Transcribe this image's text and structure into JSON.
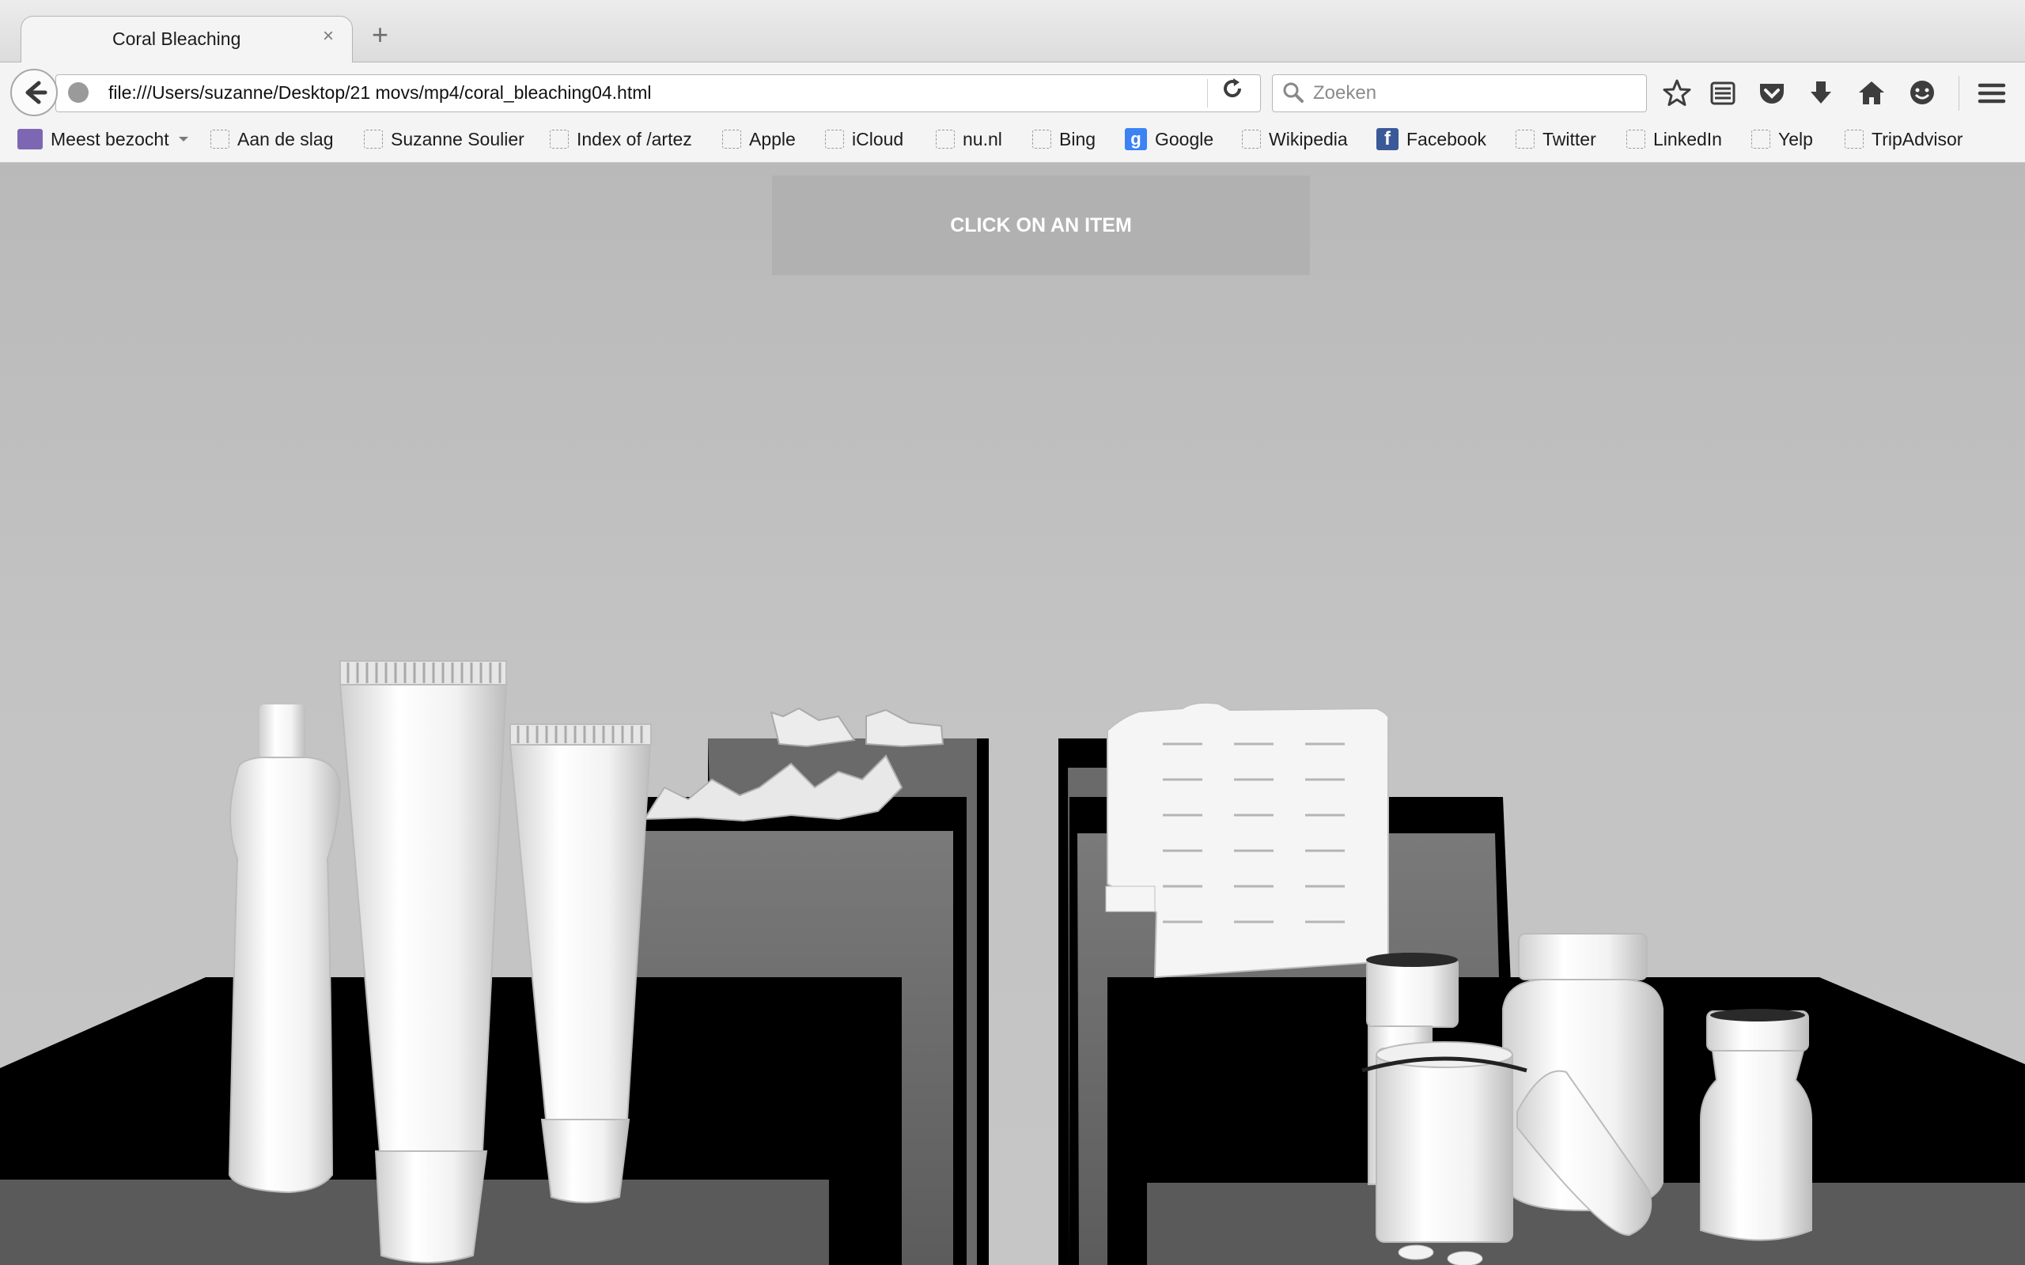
{
  "browser": {
    "tab_title": "Coral Bleaching",
    "tab_close": "×",
    "new_tab": "+",
    "url": "file:///Users/suzanne/Desktop/21 movs/mp4/coral_bleaching04.html",
    "search_placeholder": "Zoeken",
    "toolbar_icons": [
      "bookmark-star-icon",
      "reading-list-icon",
      "pocket-icon",
      "download-icon",
      "home-icon",
      "hello-chat-icon",
      "menu-icon"
    ]
  },
  "bookmarks": [
    {
      "label": "Meest bezocht",
      "icon": "folder-icon"
    },
    {
      "label": "Aan de slag",
      "icon": "blank-favicon"
    },
    {
      "label": "Suzanne Soulier",
      "icon": "blank-favicon"
    },
    {
      "label": "Index of /artez",
      "icon": "blank-favicon"
    },
    {
      "label": "Apple",
      "icon": "blank-favicon"
    },
    {
      "label": "iCloud",
      "icon": "blank-favicon"
    },
    {
      "label": "nu.nl",
      "icon": "blank-favicon"
    },
    {
      "label": "Bing",
      "icon": "blank-favicon"
    },
    {
      "label": "Google",
      "icon": "google-favicon"
    },
    {
      "label": "Wikipedia",
      "icon": "blank-favicon"
    },
    {
      "label": "Facebook",
      "icon": "facebook-favicon"
    },
    {
      "label": "Twitter",
      "icon": "blank-favicon"
    },
    {
      "label": "LinkedIn",
      "icon": "blank-favicon"
    },
    {
      "label": "Yelp",
      "icon": "blank-favicon"
    },
    {
      "label": "TripAdvisor",
      "icon": "blank-favicon"
    }
  ],
  "page": {
    "banner_text": "CLICK ON AN ITEM",
    "favicon_letters": {
      "google": "g",
      "facebook": "f"
    }
  }
}
